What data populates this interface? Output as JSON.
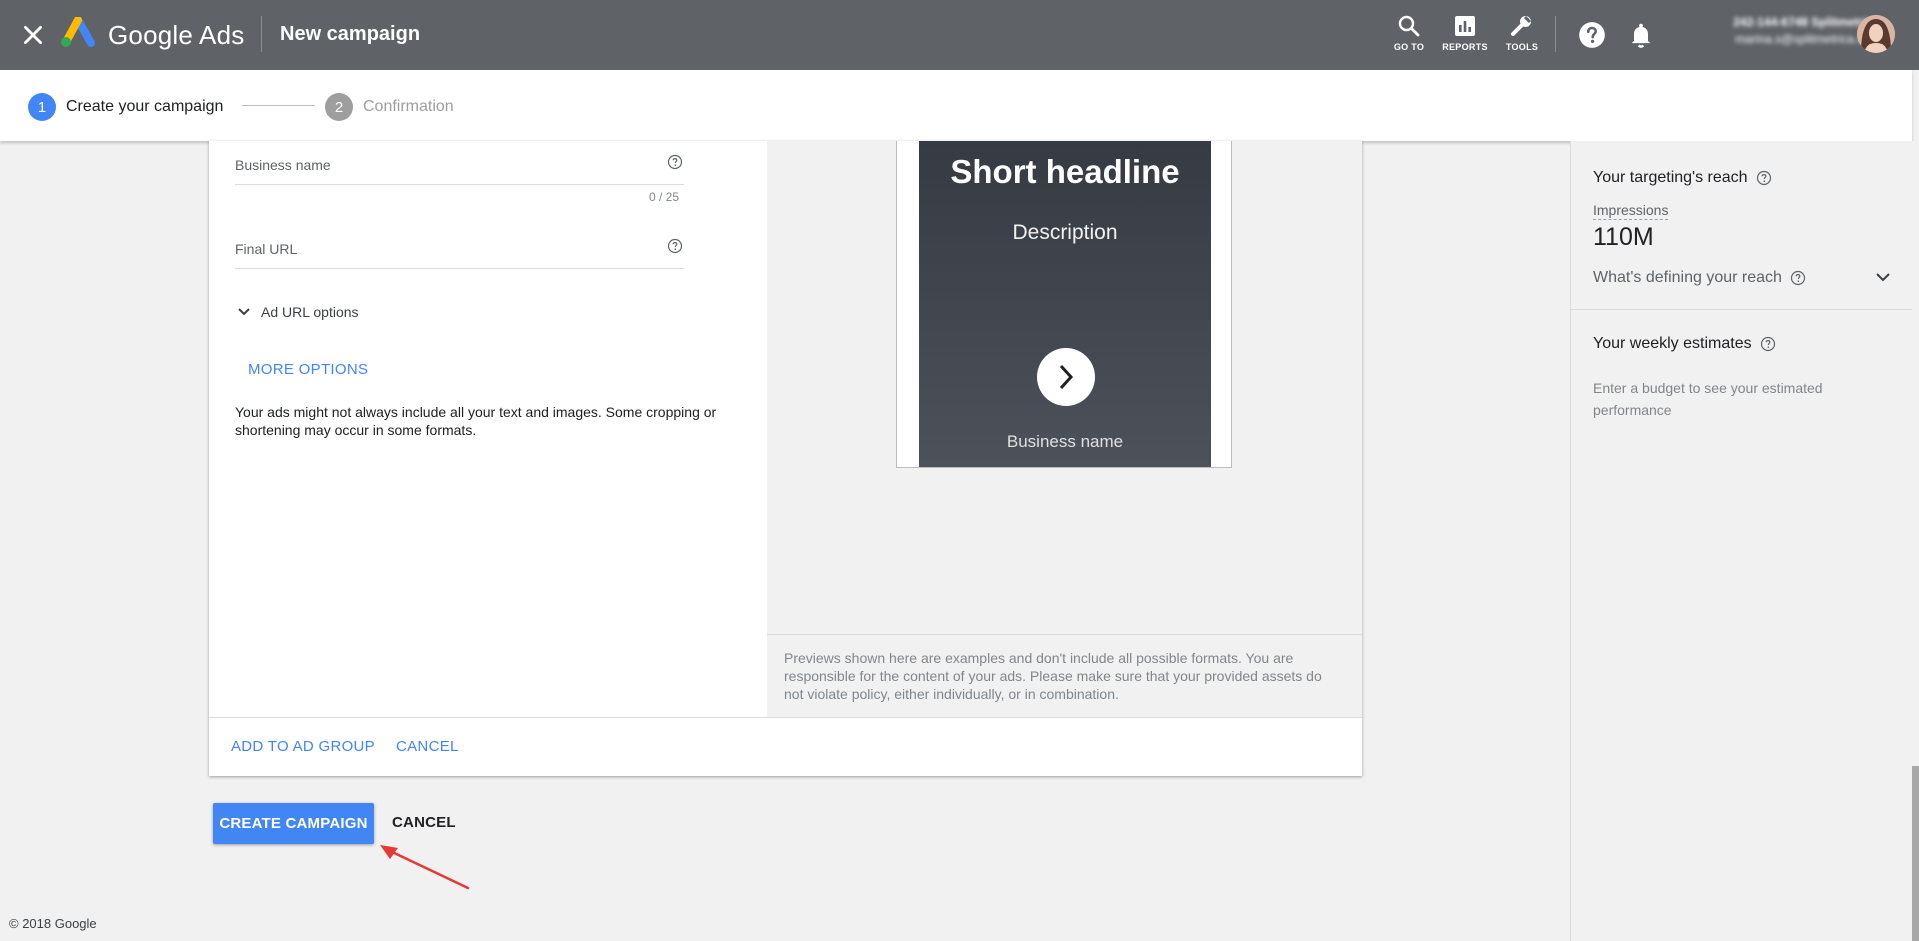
{
  "header": {
    "brand": "Google Ads",
    "page_title": "New campaign",
    "tools": {
      "goto": "GO TO",
      "reports": "REPORTS",
      "tools": "TOOLS"
    },
    "account_line1": "242-144-6748 Splitmetrica",
    "account_line2": "marina.s@splitmetrica.com"
  },
  "stepper": {
    "step1_num": "1",
    "step1_label": "Create your campaign",
    "step2_num": "2",
    "step2_label": "Confirmation"
  },
  "form": {
    "business_name_label": "Business name",
    "business_name_counter": "0 / 25",
    "final_url_label": "Final URL",
    "ad_url_options": "Ad URL options",
    "more_options": "MORE OPTIONS",
    "note": "Your ads might not always include all your text and images. Some cropping or shortening may occur in some formats."
  },
  "preview": {
    "headline": "Short headline",
    "description": "Description",
    "business_name": "Business name",
    "disclaimer": "Previews shown here are examples and don't include all possible formats. You are responsible for the content of your ads. Please make sure that your provided assets do not violate policy, either individually, or in combination."
  },
  "card_actions": {
    "add": "ADD TO AD GROUP",
    "cancel": "CANCEL"
  },
  "page_actions": {
    "create": "CREATE CAMPAIGN",
    "cancel": "CANCEL"
  },
  "footer": {
    "copyright": "© 2018 Google"
  },
  "right_panel": {
    "reach_title": "Your targeting's reach",
    "impressions_label": "Impressions",
    "impressions_value": "110M",
    "defining": "What's defining your reach",
    "weekly_title": "Your weekly estimates",
    "weekly_note": "Enter a budget to see your estimated performance"
  },
  "colors": {
    "topbar": "#5f6368",
    "accent": "#4285f4",
    "annotation_arrow": "#e53935"
  }
}
